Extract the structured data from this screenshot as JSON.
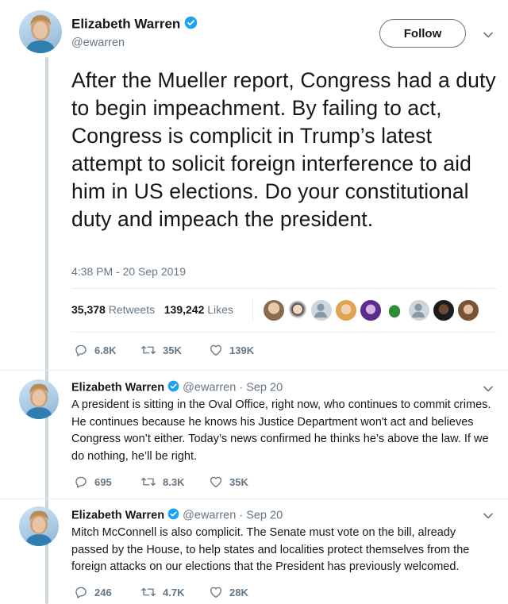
{
  "main_tweet": {
    "author_name": "Elizabeth Warren",
    "handle": "@ewarren",
    "follow_label": "Follow",
    "text": "After the Mueller report, Congress had a duty to begin impeachment. By failing to act, Congress is complicit in Trump’s latest attempt to solicit foreign interference to aid him in US elections. Do your constitutional duty and impeach the president.",
    "timestamp": "4:38 PM - 20 Sep 2019",
    "retweets_count": "35,378",
    "retweets_label": "Retweets",
    "likes_count": "139,242",
    "likes_label": "Likes",
    "replies": "6.8K",
    "retweets_short": "35K",
    "likes_short": "139K"
  },
  "replies": [
    {
      "author_name": "Elizabeth Warren",
      "handle": "@ewarren",
      "separator": "·",
      "date": "Sep 20",
      "text": "A president is sitting in the Oval Office, right now, who continues to commit crimes. He continues because he knows his Justice Department won't act and believes Congress won’t either. Today’s news confirmed he thinks he’s above the law. If we do nothing, he’ll be right.",
      "replies": "695",
      "retweets": "8.3K",
      "likes": "35K"
    },
    {
      "author_name": "Elizabeth Warren",
      "handle": "@ewarren",
      "separator": "·",
      "date": "Sep 20",
      "text": "Mitch McConnell is also complicit. The Senate must vote on the bill, already passed by the House, to help states and localities protect themselves from the foreign attacks on our elections that the President has previously welcomed.",
      "replies": "246",
      "retweets": "4.7K",
      "likes": "28K"
    }
  ],
  "colors": {
    "verified": "#1da1f2",
    "muted_text": "#657786",
    "thread_line": "#ccd6dd",
    "divider": "#e6ecf0"
  },
  "icons": [
    "verified-badge-icon",
    "chevron-down-icon",
    "reply-icon",
    "retweet-icon",
    "like-icon"
  ]
}
